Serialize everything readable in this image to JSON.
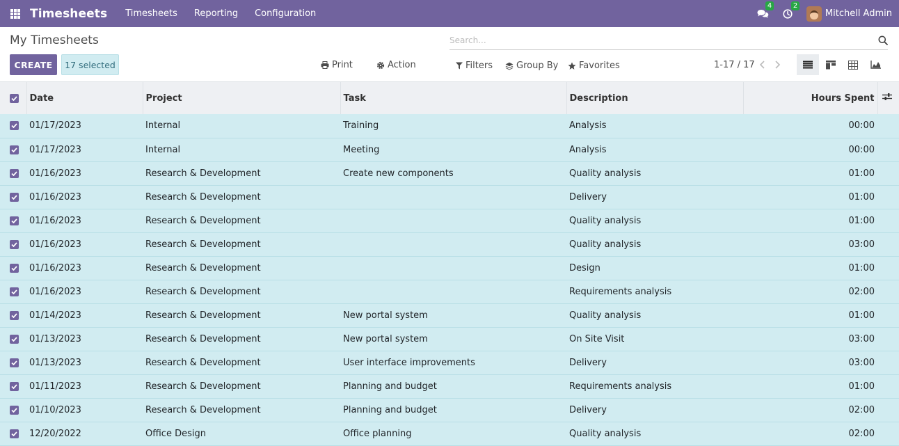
{
  "navbar": {
    "app_title": "Timesheets",
    "menu": [
      "Timesheets",
      "Reporting",
      "Configuration"
    ],
    "messages_count": "4",
    "activities_count": "2",
    "user_name": "Mitchell Admin"
  },
  "control_panel": {
    "breadcrumb": "My Timesheets",
    "search_placeholder": "Search...",
    "create_label": "CREATE",
    "selected_label": "17 selected",
    "print_label": "Print",
    "action_label": "Action",
    "filters_label": "Filters",
    "group_by_label": "Group By",
    "favorites_label": "Favorites",
    "pager": "1-17 / 17"
  },
  "table": {
    "columns": [
      "Date",
      "Project",
      "Task",
      "Description",
      "Hours Spent"
    ],
    "rows": [
      [
        "01/17/2023",
        "Internal",
        "Training",
        "Analysis",
        "00:00"
      ],
      [
        "01/17/2023",
        "Internal",
        "Meeting",
        "Analysis",
        "00:00"
      ],
      [
        "01/16/2023",
        "Research & Development",
        "Create new components",
        "Quality analysis",
        "01:00"
      ],
      [
        "01/16/2023",
        "Research & Development",
        "",
        "Delivery",
        "01:00"
      ],
      [
        "01/16/2023",
        "Research & Development",
        "",
        "Quality analysis",
        "01:00"
      ],
      [
        "01/16/2023",
        "Research & Development",
        "",
        "Quality analysis",
        "03:00"
      ],
      [
        "01/16/2023",
        "Research & Development",
        "",
        "Design",
        "01:00"
      ],
      [
        "01/16/2023",
        "Research & Development",
        "",
        "Requirements analysis",
        "02:00"
      ],
      [
        "01/14/2023",
        "Research & Development",
        "New portal system",
        "Quality analysis",
        "01:00"
      ],
      [
        "01/13/2023",
        "Research & Development",
        "New portal system",
        "On Site Visit",
        "03:00"
      ],
      [
        "01/13/2023",
        "Research & Development",
        "User interface improvements",
        "Delivery",
        "03:00"
      ],
      [
        "01/11/2023",
        "Research & Development",
        "Planning and budget",
        "Requirements analysis",
        "01:00"
      ],
      [
        "01/10/2023",
        "Research & Development",
        "Planning and budget",
        "Delivery",
        "02:00"
      ],
      [
        "12/20/2022",
        "Office Design",
        "Office planning",
        "Quality analysis",
        "02:00"
      ]
    ]
  },
  "colors": {
    "brand": "#71639e",
    "selected_row": "#d1ecf1",
    "badge": "#28a745"
  }
}
